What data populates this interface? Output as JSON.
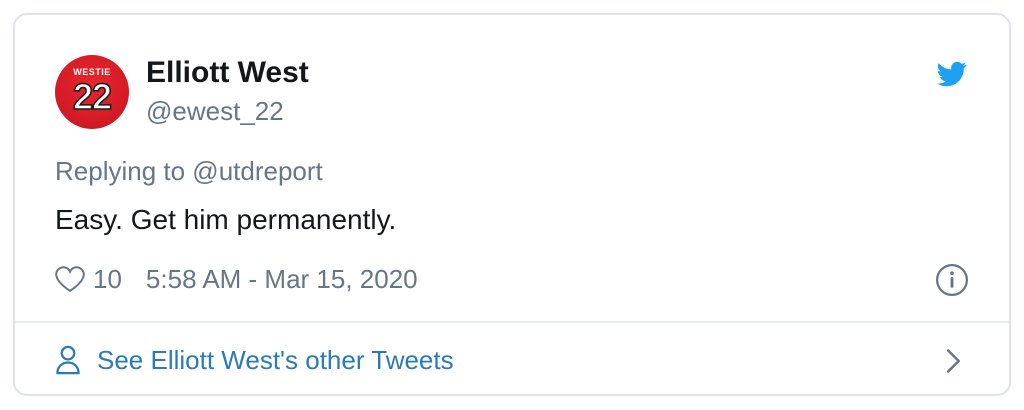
{
  "author": {
    "display_name": "Elliott West",
    "handle": "@ewest_22",
    "avatar": {
      "jersey_name": "WESTIE",
      "jersey_number": "22",
      "color": "#d11a24"
    }
  },
  "tweet": {
    "replying_to": "Replying to @utdreport",
    "text": "Easy. Get him permanently.",
    "likes": "10",
    "timestamp": "5:58 AM - Mar 15, 2020"
  },
  "footer": {
    "link_label": "See Elliott West's other Tweets"
  },
  "icons": {
    "brand": "twitter-bird-icon",
    "like": "heart-icon",
    "info": "info-icon",
    "profile": "person-icon",
    "navigate": "chevron-right-icon"
  },
  "colors": {
    "brand_blue": "#1da1f2",
    "link_blue": "#2b7bb9",
    "secondary_text": "#657786",
    "primary_text": "#14171a"
  }
}
